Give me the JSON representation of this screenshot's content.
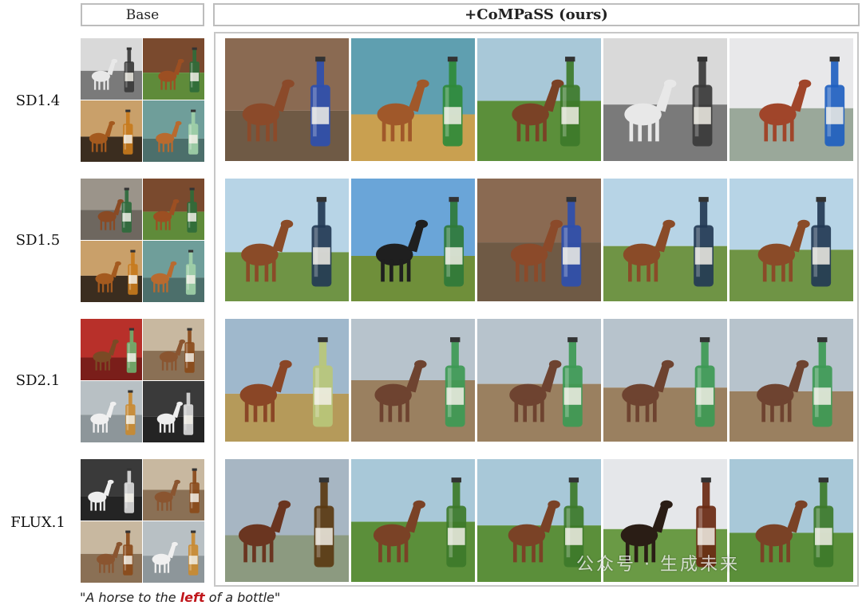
{
  "headers": {
    "base": "Base",
    "ours": "+CoMPaSS (ours)"
  },
  "rows": [
    {
      "label": "SD1.4"
    },
    {
      "label": "SD1.5"
    },
    {
      "label": "SD2.1"
    },
    {
      "label": "FLUX.1"
    }
  ],
  "caption": {
    "open": "\"A horse to the ",
    "highlight": "left",
    "close": " of a bottle\""
  },
  "watermark": "公众号 · 生成未来",
  "colors": {
    "caption_highlight": "#c0151a",
    "panel_border": "#c7c7c7"
  },
  "tile_themes": {
    "base": [
      [
        "bw-field",
        "barn",
        "sunset",
        "teal-studio"
      ],
      [
        "stone-wall",
        "barn",
        "sunset",
        "teal-studio"
      ],
      [
        "red-wall",
        "warm-room",
        "grey-studio",
        "dark-studio"
      ],
      [
        "dark-studio",
        "warm-room",
        "warm-room",
        "grey-studio"
      ]
    ],
    "ours": [
      [
        "wood-barn",
        "sunset-field",
        "green-field",
        "bw-field",
        "frosty-field"
      ],
      [
        "pasture",
        "blue-sky",
        "wood-barn",
        "pasture",
        "pasture"
      ],
      [
        "dry-field",
        "dirt-yard",
        "dirt-yard",
        "dirt-yard",
        "dirt-yard"
      ],
      [
        "mountain-lake",
        "green-field",
        "green-field",
        "white-fence",
        "green-field"
      ]
    ]
  }
}
